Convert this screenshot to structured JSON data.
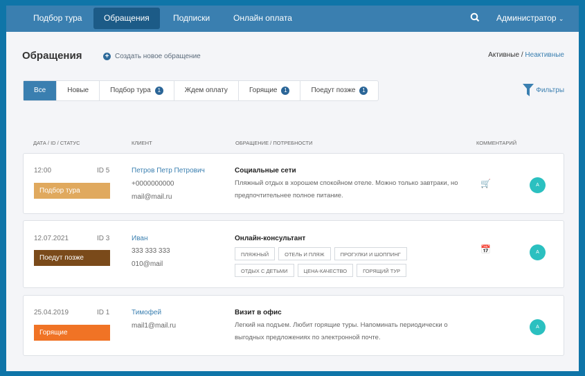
{
  "nav": {
    "items": [
      "Подбор тура",
      "Обращения",
      "Подписки",
      "Онлайн оплата"
    ],
    "active": 1,
    "user": "Администратор"
  },
  "page": {
    "title": "Обращения",
    "create": "Создать новое обращение",
    "active": "Активные",
    "separator": " / ",
    "inactive": "Неактивные",
    "filters": "Фильтры"
  },
  "tabs": [
    {
      "label": "Все"
    },
    {
      "label": "Новые"
    },
    {
      "label": "Подбор тура",
      "count": "1"
    },
    {
      "label": "Ждем оплату"
    },
    {
      "label": "Горящие",
      "count": "1"
    },
    {
      "label": "Поедут позже",
      "count": "1"
    }
  ],
  "headers": {
    "date": "Дата / ID / Статус",
    "client": "Клиент",
    "request": "Обращение / Потребности",
    "comment": "Комментарий"
  },
  "rows": [
    {
      "date": "12:00",
      "id": "ID 5",
      "status": "Подбор тура",
      "status_color": "#e0a95e",
      "name": "Петров Петр Петрович",
      "phone": "+0000000000",
      "email": "mail@mail.ru",
      "title": "Социальные сети",
      "desc": "Пляжный отдых в хорошем спокойном отеле. Можно только завтраки, но предпочтительнее полное питание.",
      "icon": "cart-icon",
      "avatar": "A"
    },
    {
      "date": "12.07.2021",
      "id": "ID 3",
      "status": "Поедут позже",
      "status_color": "#7a4a1a",
      "name": "Иван",
      "phone": "333 333 333",
      "email": "010@mail",
      "title": "Онлайн-консультант",
      "tags": [
        "Пляжный",
        "Отель и пляж",
        "Прогулки и шоппинг",
        "Отдых с детьми",
        "Цена-качество",
        "Горящий тур"
      ],
      "icon": "calendar-icon",
      "avatar": "A"
    },
    {
      "date": "25.04.2019",
      "id": "ID 1",
      "status": "Горящие",
      "status_color": "#f07325",
      "name": "Тимофей",
      "email": "mail1@mail.ru",
      "title": "Визит в офис",
      "desc": "Легкий на подъем. Любит горящие туры. Напоминать периодически о выгодных предложениях по электронной почте.",
      "avatar": "A"
    }
  ]
}
